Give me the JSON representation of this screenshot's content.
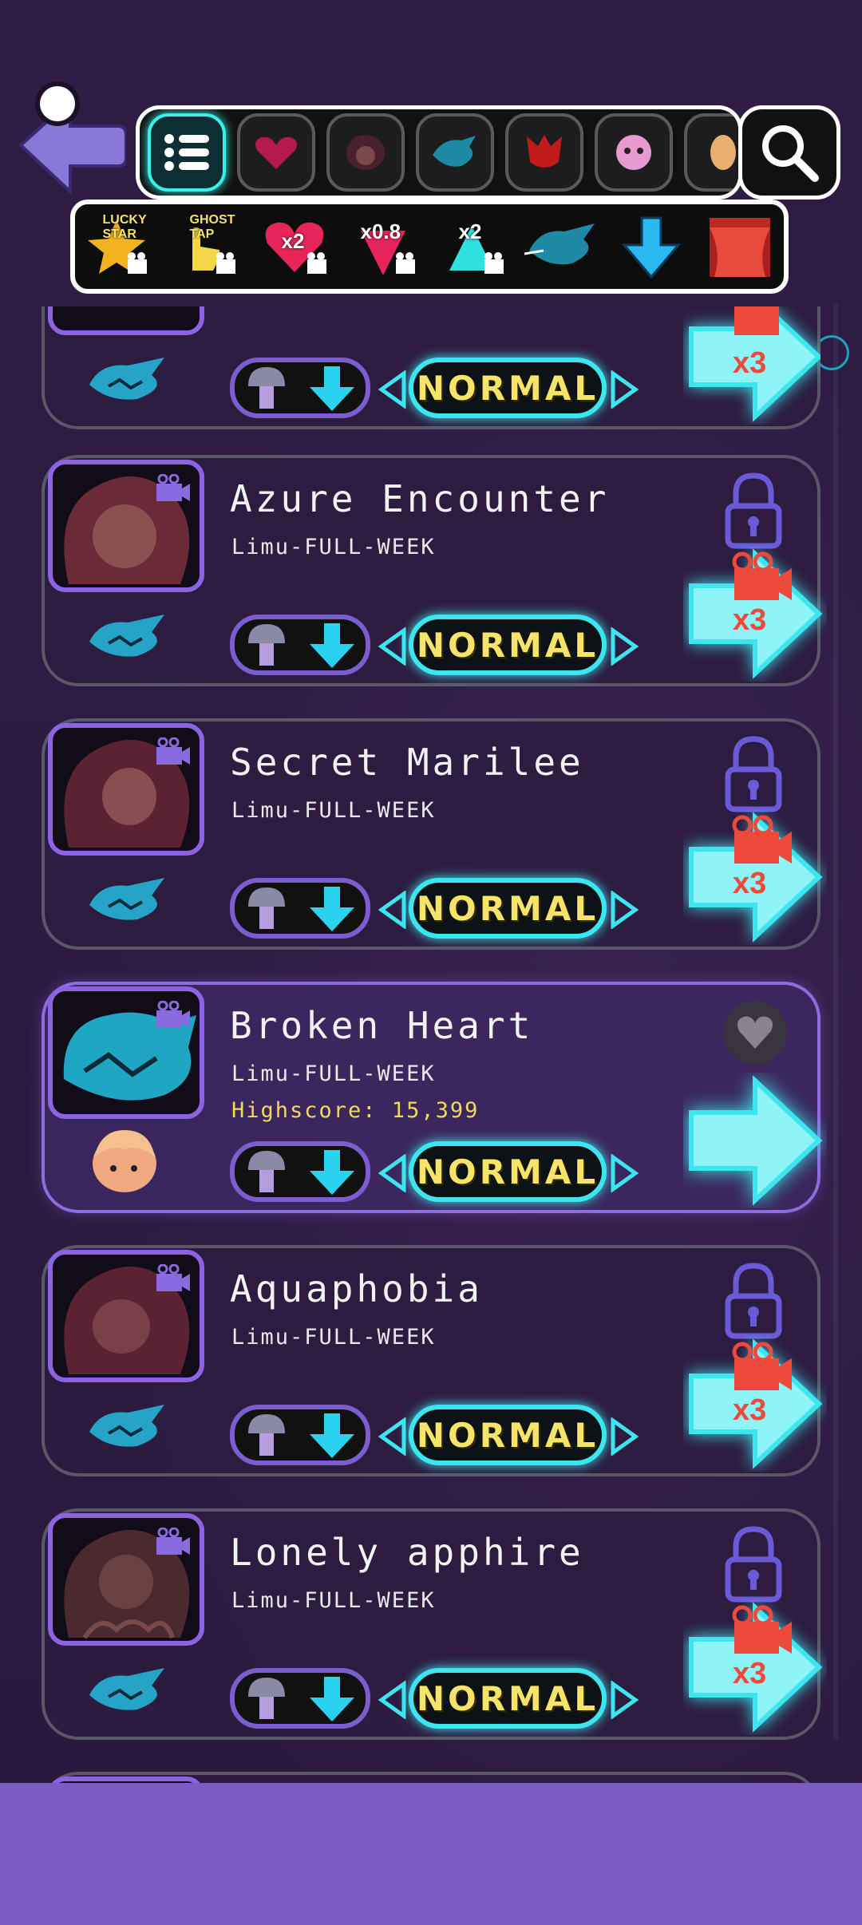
{
  "nav": {
    "categories": [
      "list",
      "heart",
      "girl",
      "bird",
      "demon",
      "pink",
      "more"
    ],
    "active_index": 0
  },
  "modifiers": [
    {
      "name": "lucky-star",
      "label": "LUCKY STAR"
    },
    {
      "name": "ghost-tap",
      "label": "GHOST TAP"
    },
    {
      "name": "heart-x2",
      "label": "x2"
    },
    {
      "name": "speed",
      "label": "x0.8"
    },
    {
      "name": "scroll",
      "label": "x2"
    },
    {
      "name": "opponent",
      "label": ""
    },
    {
      "name": "arrow",
      "label": ""
    },
    {
      "name": "stage",
      "label": ""
    }
  ],
  "songs": [
    {
      "title": "",
      "subtitle": "",
      "difficulty": "NORMAL",
      "locked": true,
      "reward": "x3",
      "selected": false
    },
    {
      "title": "Azure Encounter",
      "subtitle": "Limu-FULL-WEEK",
      "difficulty": "NORMAL",
      "locked": true,
      "reward": "x3",
      "selected": false
    },
    {
      "title": "Secret Marilee",
      "subtitle": "Limu-FULL-WEEK",
      "difficulty": "NORMAL",
      "locked": true,
      "reward": "x3",
      "selected": false
    },
    {
      "title": "Broken Heart",
      "subtitle": "Limu-FULL-WEEK",
      "highscore": "Highscore: 15,399",
      "difficulty": "NORMAL",
      "locked": false,
      "reward": "",
      "selected": true
    },
    {
      "title": "Aquaphobia",
      "subtitle": "Limu-FULL-WEEK",
      "difficulty": "NORMAL",
      "locked": true,
      "reward": "x3",
      "selected": false
    },
    {
      "title": "Lonely apphire",
      "subtitle": "Limu-FULL-WEEK",
      "difficulty": "NORMAL",
      "locked": true,
      "reward": "x3",
      "selected": false
    }
  ],
  "colors": {
    "accent_cyan": "#3de6ee",
    "accent_purple": "#8c63e2",
    "difficulty_text": "#f5e36a",
    "reward_red": "#ee4a3c"
  }
}
